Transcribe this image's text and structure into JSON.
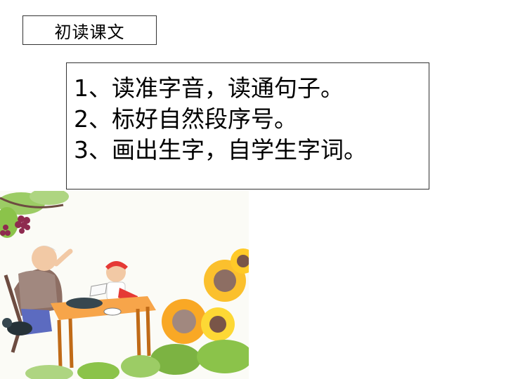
{
  "header": {
    "title": "初读课文"
  },
  "tasks": [
    "1、读准字音，读通句子。",
    "2、标好自然段序号。",
    "3、画出生字，自学生字词。"
  ],
  "illustration": {
    "icon": "grandmother-child-sunflowers-illustration"
  }
}
